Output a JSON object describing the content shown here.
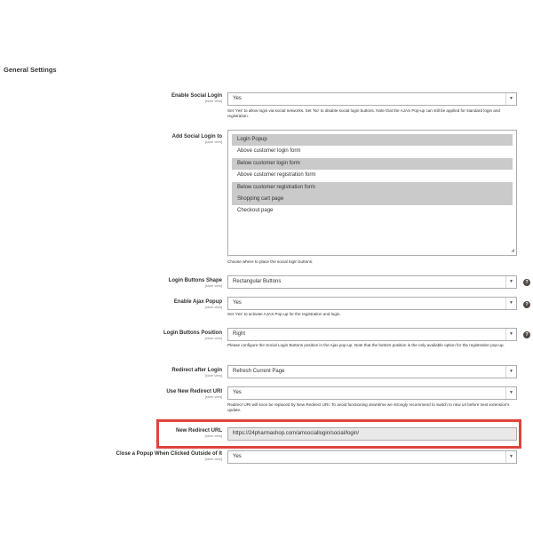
{
  "section_title": "General Settings",
  "scope_label": "[store view]",
  "help_glyph": "?",
  "arrow_glyph": "▼",
  "fields": {
    "enable_social_login": {
      "label": "Enable Social Login",
      "value": "Yes",
      "note": "Set 'Yes' to allow login via social networks. Set 'No' to disable social login buttons. Note that the AJAX Pop-up can still be applied for standard login and registration."
    },
    "add_social_login_to": {
      "label": "Add Social Login to",
      "options": [
        {
          "label": "Login Popup",
          "selected": true
        },
        {
          "label": "Above customer login form",
          "selected": false
        },
        {
          "label": "Below customer login form",
          "selected": true
        },
        {
          "label": "Above customer registration form",
          "selected": false
        },
        {
          "label": "Below customer registration form",
          "selected": true
        },
        {
          "label": "Shopping cart page",
          "selected": true
        },
        {
          "label": "Checkout page",
          "selected": false
        }
      ],
      "note": "Choose where to place the social login buttons."
    },
    "login_buttons_shape": {
      "label": "Login Buttons Shape",
      "value": "Rectangular Buttons"
    },
    "enable_ajax_popup": {
      "label": "Enable Ajax Popup",
      "value": "Yes",
      "note": "Set 'Yes' to activate AJAX Pop-up for the registration and login."
    },
    "login_buttons_position": {
      "label": "Login Buttons Position",
      "value": "Right",
      "note": "Please configure the Social Login Buttons position in the Ajax pop-up. Note that the bottom position is the only available option for the registration pop-up."
    },
    "redirect_after_login": {
      "label": "Redirect after Login",
      "value": "Refresh Current Page"
    },
    "use_new_redirect_uri": {
      "label": "Use New Redirect URI",
      "value": "Yes",
      "note": "Redirect URI will soon be replaced by New Redirect URI. To avoid functioning downtime we strongly recommend to switch to new url before next extension's update."
    },
    "new_redirect_url": {
      "label": "New Redirect URL",
      "value": "https://24pharmashop.com/amsociallogin/social/login/"
    },
    "close_popup_outside": {
      "label": "Close a Popup When Clicked Outside of It",
      "value": "Yes"
    }
  },
  "colors": {
    "highlight": "#e0443a",
    "selected_option": "#cacaca",
    "disabled_field": "#e9e9e9"
  }
}
